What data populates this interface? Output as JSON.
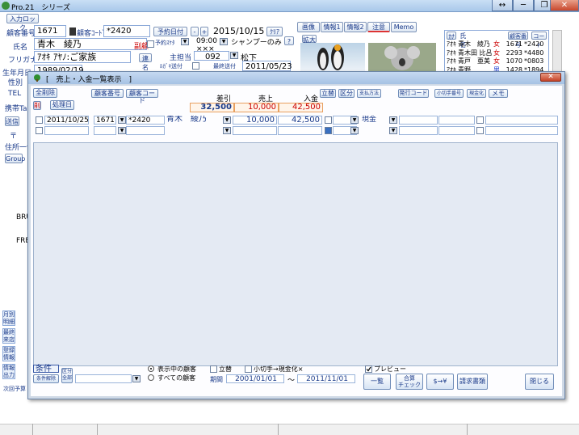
{
  "app": {
    "title": "Pro.21　シリーズ",
    "win_buttons": [
      "↔",
      "─",
      "❐",
      "✕"
    ]
  },
  "bgform": {
    "input_lock": "入力ロック",
    "customer_no_label": "顧客番号",
    "customer_no": "1671",
    "customer_code_label": "顧客ｺｰﾄﾞ",
    "customer_code": "*2420",
    "reservation_btn": "予約日付",
    "date": "2015/10/15",
    "clear_btn": "ｸﾘｱ",
    "name_label": "氏名",
    "name": "青木　綾乃",
    "sub_label": "副顧",
    "furigana_label": "フリガナ",
    "furigana": "ｱｵｷ ｱﾔﾉ:ご家族",
    "family_btn": "連名",
    "reservation_time_label": "予約ｽｹﾀ",
    "reservation_time": "09:00",
    "reservation_xs": "×××",
    "menu": "シャンプーのみ",
    "question_btn": "?",
    "staff_label": "主担当",
    "staff_code": "092",
    "staff_name": "松下",
    "dm_label": "ﾙｶﾞｷ送付",
    "last_visit_label": "最終送付",
    "last_visit": "2011/05/23",
    "birth_label": "生年月日",
    "birth": "1989/02/19",
    "gender_label": "性別",
    "tel_label": "TEL",
    "mobile_label": "携帯Ta",
    "address_label": "住所一ﾔ",
    "postal_label": "〒",
    "send_btn": "送信",
    "group_btn": "Group",
    "tabs": [
      "画像",
      "情報1",
      "情報2",
      "注意",
      "Memo"
    ],
    "enlarge_btn": "拡大",
    "left_buttons": [
      "月別\n明細",
      "最終\n来店",
      "登録\n情報",
      "情報\n出力"
    ],
    "next_visit": "次回予算",
    "bru": "BRU",
    "fre": "FRE"
  },
  "customer_list": {
    "headers": {
      "kana": "ｶﾅ",
      "name": "氏名",
      "no_btn": "顧客番号",
      "code_btn": "コード"
    },
    "rows": [
      {
        "kana": "ｱｵｷ",
        "name": "青木　綾乃",
        "sex": "女",
        "no": "1671",
        "code": "*2420"
      },
      {
        "kana": "ｱｵｷ",
        "name": "青木田 比呂",
        "sex": "女",
        "no": "2293",
        "code": "*4480"
      },
      {
        "kana": "ｱｵｷ",
        "name": "青戸　亜美",
        "sex": "女",
        "no": "1070",
        "code": "*0803"
      },
      {
        "kana": "ｱｵｷ",
        "name": "青野",
        "sex": "男",
        "no": "1428",
        "code": "*1894"
      },
      {
        "kana": "ｱｵｷ",
        "name": "亜鳳",
        "sex": "男",
        "no": "1935",
        "code": "*0650"
      }
    ]
  },
  "dialog": {
    "title": "[　売上・入金一覧表示　]",
    "close_label": "✕",
    "toolbar": {
      "clear_all": "全削除",
      "delete": "削",
      "processing_day": "処理日",
      "customer_no": "顧客番号",
      "customer_code": "顧客コード",
      "advance": "立替",
      "category": "区分",
      "payment_method": "支払方法",
      "issue_code": "発行コード",
      "check_no": "小切手番号",
      "cash": "現金化",
      "memo": "メモ"
    },
    "totals": {
      "discount_label": "差引",
      "sales_label": "売上",
      "deposit_label": "入金",
      "discount": "32,500",
      "sales": "10,000",
      "deposit": "42,500"
    },
    "rows": [
      {
        "date": "2011/10/25",
        "no": "1671",
        "code": "*2420",
        "name": "青木　綾乃",
        "sales": "10,000",
        "deposit": "42,500",
        "method": "現金"
      }
    ],
    "footer": {
      "conditions": "条件",
      "cond_clear": "条件解除",
      "cond_all": "区分\n全部",
      "radio_shown": "表示中の顧客",
      "radio_all": "すべての顧客",
      "advance": "立替",
      "check_cash": "小切手→現金化×",
      "period_label": "期間",
      "date_from": "2001/01/01",
      "tilde": "〜",
      "date_to": "2011/11/01",
      "preview": "プレビュー",
      "list_btn": "一覧",
      "total_check_btn": "合算\nチェック",
      "convert_btn": "$→¥",
      "request_btn": "請求書類",
      "close_btn": "閉じる"
    }
  }
}
